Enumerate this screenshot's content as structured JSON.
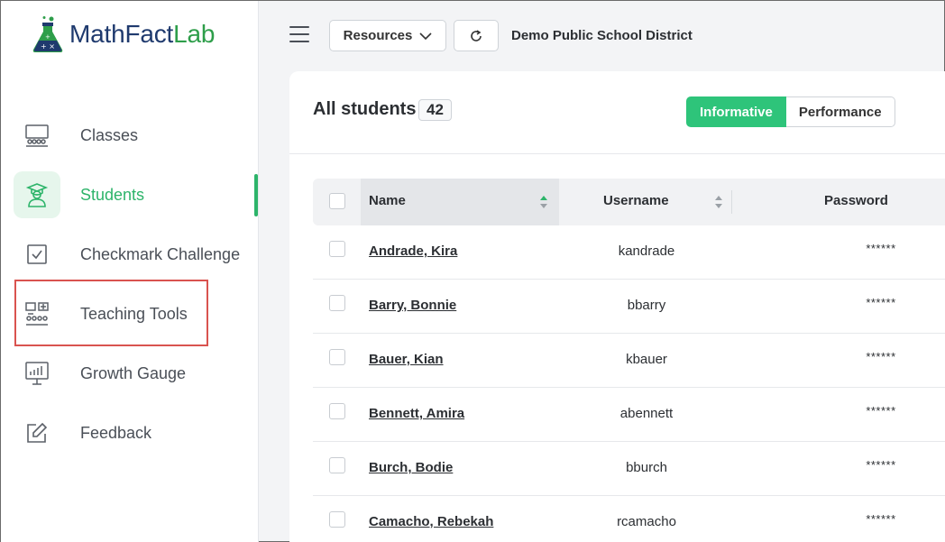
{
  "app": {
    "logo_math": "MathFact",
    "logo_lab": "Lab",
    "brand_green": "#2db46a",
    "brand_navy": "#1f3a6e"
  },
  "sidebar": {
    "items": [
      {
        "label": "Classes",
        "icon": "classroom-icon"
      },
      {
        "label": "Students",
        "icon": "student-icon",
        "active": true
      },
      {
        "label": "Checkmark Challenge",
        "icon": "checkbox-icon"
      },
      {
        "label": "Teaching Tools",
        "icon": "teaching-tools-icon",
        "highlighted": true
      },
      {
        "label": "Growth Gauge",
        "icon": "growth-chart-icon"
      },
      {
        "label": "Feedback",
        "icon": "edit-icon"
      }
    ]
  },
  "topbar": {
    "resources_label": "Resources",
    "district": "Demo Public School District"
  },
  "main": {
    "title": "All students",
    "count": "42",
    "toggle": {
      "informative": "Informative",
      "performance": "Performance",
      "selected": "Informative"
    }
  },
  "table": {
    "headers": {
      "name": "Name",
      "username": "Username",
      "password": "Password"
    },
    "rows": [
      {
        "name": "Andrade, Kira",
        "username": "kandrade",
        "password": "******"
      },
      {
        "name": "Barry, Bonnie",
        "username": "bbarry",
        "password": "******"
      },
      {
        "name": "Bauer, Kian",
        "username": "kbauer",
        "password": "******"
      },
      {
        "name": "Bennett, Amira",
        "username": "abennett",
        "password": "******"
      },
      {
        "name": "Burch, Bodie",
        "username": "bburch",
        "password": "******"
      },
      {
        "name": "Camacho, Rebekah",
        "username": "rcamacho",
        "password": "******"
      }
    ]
  }
}
